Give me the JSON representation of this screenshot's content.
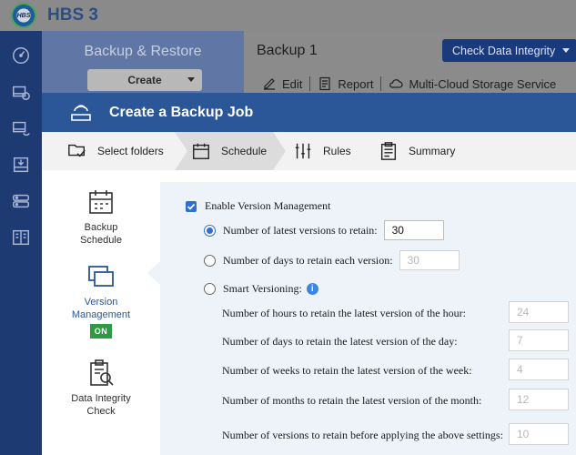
{
  "app": {
    "title": "HBS 3",
    "logo_text": "HBS"
  },
  "sidebar": {
    "title": "Backup & Restore",
    "create_label": "Create"
  },
  "job": {
    "title": "Backup 1",
    "check_integrity_label": "Check Data Integrity",
    "actions": [
      {
        "label": "Edit",
        "icon": "edit-icon"
      },
      {
        "label": "Report",
        "icon": "report-icon"
      },
      {
        "label": "Multi-Cloud Storage Service",
        "icon": "cloud-icon"
      }
    ]
  },
  "modal": {
    "title": "Create a Backup Job",
    "steps": [
      {
        "label": "Select folders",
        "icon": "folder-check-icon"
      },
      {
        "label": "Schedule",
        "icon": "calendar-icon",
        "active": true
      },
      {
        "label": "Rules",
        "icon": "sliders-icon"
      },
      {
        "label": "Summary",
        "icon": "clipboard-icon"
      }
    ],
    "side_tabs": [
      {
        "label1": "Backup",
        "label2": "Schedule",
        "icon": "calendar-icon"
      },
      {
        "label1": "Version",
        "label2": "Management",
        "badge": "ON",
        "icon": "windows-icon",
        "active": true
      },
      {
        "label1": "Data Integrity",
        "label2": "Check",
        "icon": "clipboard-search-icon"
      }
    ],
    "version": {
      "enable_label": "Enable Version Management",
      "latest_label": "Number of latest versions to retain:",
      "latest_value": "30",
      "days_label": "Number of days to retain each version:",
      "days_value": "30",
      "smart_label": "Smart Versioning:",
      "smart_rows": [
        {
          "label": "Number of hours to retain the latest version of the hour:",
          "value": "24"
        },
        {
          "label": "Number of days to retain the latest version of the day:",
          "value": "7"
        },
        {
          "label": "Number of weeks to retain the latest version of the week:",
          "value": "4"
        },
        {
          "label": "Number of months to retain the latest version of the month:",
          "value": "12"
        },
        {
          "label": "Number of versions to retain before applying the above settings:",
          "value": "10"
        }
      ]
    }
  },
  "colors": {
    "modal_header": "#2b5698",
    "accent": "#2f6fd1",
    "badge_on": "#2d9b3f",
    "nav_bg": "#1e3a73"
  }
}
